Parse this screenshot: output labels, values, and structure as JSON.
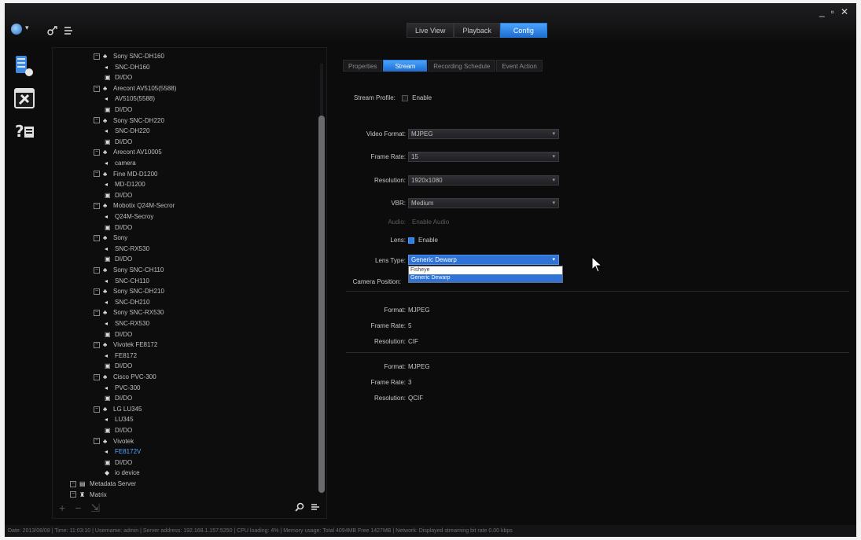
{
  "window": {
    "controls": [
      "_",
      "▫",
      "✕"
    ]
  },
  "main_tabs": [
    {
      "label": "Live View",
      "active": false
    },
    {
      "label": "Playback",
      "active": false
    },
    {
      "label": "Config",
      "active": true
    }
  ],
  "tree": {
    "nodes": [
      {
        "label": "Sony SNC-DH160",
        "level": 0,
        "type": "camera-group"
      },
      {
        "label": "SNC-DH160",
        "level": 1,
        "type": "camera"
      },
      {
        "label": "DI/DO",
        "level": 1,
        "type": "dido"
      },
      {
        "label": "Arecont AV5105(5588)",
        "level": 0,
        "type": "camera-group"
      },
      {
        "label": "AV5105(5588)",
        "level": 1,
        "type": "camera"
      },
      {
        "label": "DI/DO",
        "level": 1,
        "type": "dido"
      },
      {
        "label": "Sony SNC-DH220",
        "level": 0,
        "type": "camera-group"
      },
      {
        "label": "SNC-DH220",
        "level": 1,
        "type": "camera"
      },
      {
        "label": "DI/DO",
        "level": 1,
        "type": "dido"
      },
      {
        "label": "Arecont AV10005",
        "level": 0,
        "type": "camera-group"
      },
      {
        "label": "camera",
        "level": 1,
        "type": "camera"
      },
      {
        "label": "Fine MD-D1200",
        "level": 0,
        "type": "camera-group"
      },
      {
        "label": "MD-D1200",
        "level": 1,
        "type": "camera"
      },
      {
        "label": "DI/DO",
        "level": 1,
        "type": "dido"
      },
      {
        "label": "Mobotix Q24M-Secror",
        "level": 0,
        "type": "camera-group"
      },
      {
        "label": "Q24M-Secroy",
        "level": 1,
        "type": "camera"
      },
      {
        "label": "DI/DO",
        "level": 1,
        "type": "dido"
      },
      {
        "label": "Sony",
        "level": 0,
        "type": "camera-group"
      },
      {
        "label": "SNC-RX530",
        "level": 1,
        "type": "camera"
      },
      {
        "label": "DI/DO",
        "level": 1,
        "type": "dido"
      },
      {
        "label": "Sony SNC-CH110",
        "level": 0,
        "type": "camera-group"
      },
      {
        "label": "SNC-CH110",
        "level": 1,
        "type": "camera"
      },
      {
        "label": "Sony SNC-DH210",
        "level": 0,
        "type": "camera-group"
      },
      {
        "label": "SNC-DH210",
        "level": 1,
        "type": "camera"
      },
      {
        "label": "Sony SNC-RX530",
        "level": 0,
        "type": "camera-group"
      },
      {
        "label": "SNC-RX530",
        "level": 1,
        "type": "camera"
      },
      {
        "label": "DI/DO",
        "level": 1,
        "type": "dido"
      },
      {
        "label": "Vivotek FE8172",
        "level": 0,
        "type": "camera-group"
      },
      {
        "label": "FE8172",
        "level": 1,
        "type": "camera"
      },
      {
        "label": "DI/DO",
        "level": 1,
        "type": "dido"
      },
      {
        "label": "Cisco PVC-300",
        "level": 0,
        "type": "camera-group"
      },
      {
        "label": "PVC-300",
        "level": 1,
        "type": "camera"
      },
      {
        "label": "DI/DO",
        "level": 1,
        "type": "dido"
      },
      {
        "label": "LG LU345",
        "level": 0,
        "type": "camera-group"
      },
      {
        "label": "LU345",
        "level": 1,
        "type": "camera"
      },
      {
        "label": "DI/DO",
        "level": 1,
        "type": "dido"
      },
      {
        "label": "Vivotek",
        "level": 0,
        "type": "camera-group"
      },
      {
        "label": "FE8172V",
        "level": 1,
        "type": "camera",
        "highlighted": true
      },
      {
        "label": "DI/DO",
        "level": 1,
        "type": "dido"
      },
      {
        "label": "io device",
        "level": 0,
        "type": "io"
      },
      {
        "label": "Metadata Server",
        "level": -1,
        "type": "server"
      },
      {
        "label": "Matrix",
        "level": -1,
        "type": "matrix"
      }
    ]
  },
  "sub_tabs": [
    {
      "label": "Properties",
      "active": false
    },
    {
      "label": "Stream",
      "active": true
    },
    {
      "label": "Recording Schedule",
      "active": false
    },
    {
      "label": "Event Action",
      "active": false
    }
  ],
  "stream": {
    "stream_profile_label": "Stream Profile:",
    "stream_profile_check": "Enable",
    "video_format_label": "Video Format:",
    "video_format_value": "MJPEG",
    "frame_rate_label": "Frame Rate:",
    "frame_rate_value": "15",
    "resolution_label": "Resolution:",
    "resolution_value": "1920x1080",
    "vbr_label": "VBR:",
    "vbr_value": "Medium",
    "audio_label": "Audio:",
    "audio_check": "Enable Audio",
    "lens_label": "Lens:",
    "lens_check": "Enable",
    "lens_type_label": "Lens Type:",
    "lens_type_value": "Generic Dewarp",
    "lens_type_options": [
      "Fisheye",
      "Generic Dewarp"
    ],
    "camera_position_label": "Camera Position:"
  },
  "stream2": {
    "format_label": "Format:",
    "format_value": "MJPEG",
    "frame_rate_label": "Frame Rate:",
    "frame_rate_value": "5",
    "resolution_label": "Resolution:",
    "resolution_value": "CIF"
  },
  "stream3": {
    "format_label": "Format:",
    "format_value": "MJPEG",
    "frame_rate_label": "Frame Rate:",
    "frame_rate_value": "3",
    "resolution_label": "Resolution:",
    "resolution_value": "QCIF"
  },
  "tree_footer": {
    "add": "+",
    "remove": "−",
    "collapse": "⇲"
  },
  "status": "Date: 2013/08/08 | Time: 11:03:10 | Username: admin | Server address: 192.168.1.157:5250 | CPU loading: 4% | Memory usage: Total 4094MB Free 1427MB | Network: Displayed streaming bit rate   0.00 kbps"
}
